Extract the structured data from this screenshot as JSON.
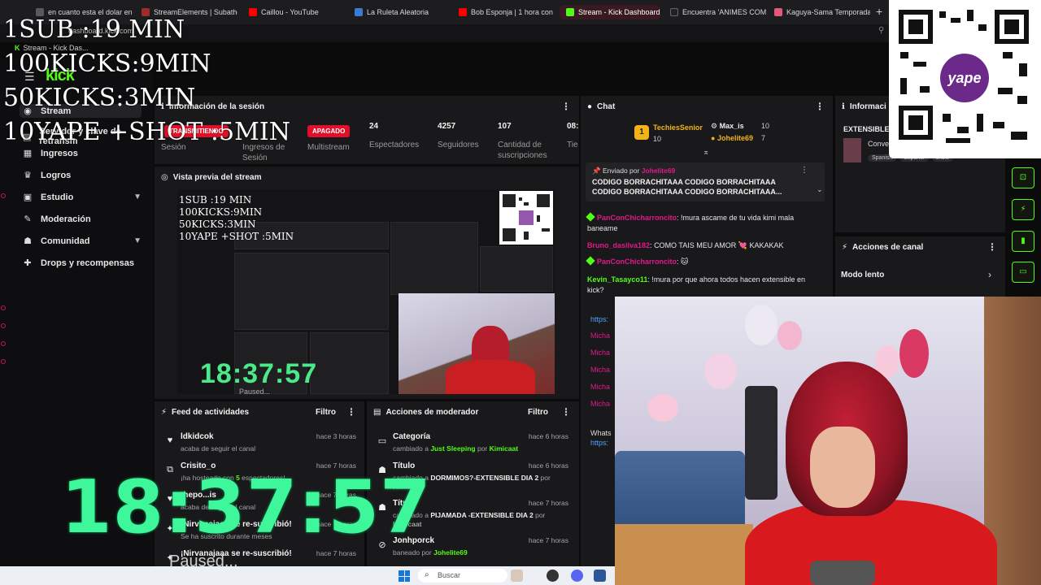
{
  "browser": {
    "tabs": [
      {
        "label": "en cuanto esta el dolar en",
        "color": "#5a5a5a"
      },
      {
        "label": "StreamElements | Subatho",
        "color": "#9b2d2d"
      },
      {
        "label": "Caillou - YouTube",
        "color": "#ff0000"
      },
      {
        "label": "La Ruleta Aleatoria",
        "color": "#3a7bd5"
      },
      {
        "label": "Bob Esponja | 1 hora con",
        "color": "#ff0000"
      },
      {
        "label": "Stream - Kick Dashboard",
        "color": "#53fc18"
      },
      {
        "label": "Encuentra 'ANIMES COM",
        "color": "#222"
      },
      {
        "label": "Kaguya-Sama Temporada",
        "color": "#e05a7a"
      }
    ],
    "address": "dashboard.kick.com",
    "pinned_tab": "Stream - Kick Das..."
  },
  "sidebar": {
    "logo": "kick",
    "items": [
      {
        "label": "Stream",
        "icon": "stream-icon"
      },
      {
        "label": "Servidor y clave de retransm",
        "icon": "server-icon"
      },
      {
        "label": "Ingresos",
        "icon": "money-icon"
      },
      {
        "label": "Logros",
        "icon": "trophy-icon"
      },
      {
        "label": "Estudio",
        "icon": "studio-icon"
      },
      {
        "label": "Moderación",
        "icon": "wrench-icon"
      },
      {
        "label": "Comunidad",
        "icon": "community-icon"
      },
      {
        "label": "Drops y recompensas",
        "icon": "gift-icon"
      }
    ]
  },
  "session": {
    "title": "Información de la sesión",
    "status_live": "TRANSMITIENDO",
    "status_off": "APAGADO",
    "stats": [
      {
        "value": "",
        "label": "Sesión"
      },
      {
        "value": "",
        "label": "Ingresos de Sesión"
      },
      {
        "value": "",
        "label": "Multistream"
      },
      {
        "value": "24",
        "label": "Espectadores"
      },
      {
        "value": "4257",
        "label": "Seguidores"
      },
      {
        "value": "107",
        "label": "Cantidad de suscripciones"
      },
      {
        "value": "08:",
        "label": "Tie"
      }
    ]
  },
  "preview": {
    "title": "Vista previa del stream",
    "mini_clock": "18:37:57",
    "mini_paused": "Paused..."
  },
  "feed": {
    "title": "Feed de actividades",
    "filter": "Filtro",
    "rows": [
      {
        "icon": "heart-icon",
        "user": "ldkidcok",
        "pre": "acaba de seguir el canal",
        "hl": "",
        "post": "",
        "time": "hace 3 horas"
      },
      {
        "icon": "host-icon",
        "user": "Crisito_o",
        "pre": "¡ha hosteado con ",
        "hl": "5",
        "post": " espectadores!",
        "time": "hace 7 horas"
      },
      {
        "icon": "heart-icon",
        "user": "thepo...is",
        "pre": "acaba de seguir el canal",
        "hl": "",
        "post": "",
        "time": "hace 7 horas"
      },
      {
        "icon": "star-icon",
        "user": "¡Nirvanajaaa se re-suscribió!",
        "pre": "Se ha suscrito durante ",
        "hl": "",
        "post": "meses",
        "time": "hace 7 horas"
      },
      {
        "icon": "star-icon",
        "user": "¡Nirvanajaaa se re-suscribió!",
        "pre": "",
        "hl": "",
        "post": "",
        "time": "hace 7 horas"
      }
    ]
  },
  "mod": {
    "title": "Acciones de moderador",
    "filter": "Filtro",
    "rows": [
      {
        "icon": "category-icon",
        "title": "Categoría",
        "pre": "cambiado a ",
        "hl": "Just Sleeping",
        "mid": " por ",
        "hl2": "Kimicaat",
        "time": "hace 6 horas"
      },
      {
        "icon": "user-icon",
        "title": "Título",
        "pre": "cambiado a ",
        "hl": "DORMIMOS?-EXTENSIBLE DIA 2",
        "mid": " por",
        "hl2": "Kimicaat",
        "time": "hace 6 horas"
      },
      {
        "icon": "user-icon",
        "title": "Título",
        "pre": "cambiado a ",
        "hl": "PIJAMADA -EXTENSIBLE DIA 2",
        "mid": " por",
        "hl2": "Kimicaat",
        "time": "hace 7 horas"
      },
      {
        "icon": "ban-icon",
        "title": "Jonhporck",
        "pre": "baneado por ",
        "hl": "",
        "mid": "",
        "hl2": "Johelite69",
        "time": "hace 7 horas"
      }
    ]
  },
  "chat": {
    "title": "Chat",
    "top_gifter": {
      "rank": "1",
      "name": "TechiesSenior",
      "count": "10"
    },
    "gifters": [
      {
        "name": "Max_is",
        "count": "10"
      },
      {
        "name": "Johelite69",
        "count": "7"
      }
    ],
    "pinned_by": "Enviado por",
    "pinned_user": "Johelite69",
    "pinned_msg": "CODIGO BORRACHITAAA CODIGO BORRACHITAAA CODIGO BORRACHITAAA CODIGO BORRACHITAAA...",
    "messages": [
      {
        "user": "PanConChicharroncito",
        "color": "#e0198a",
        "text": "!mura ascame de tu vida kimi mala baneame",
        "badge": true
      },
      {
        "user": "Bruno_dasilva182",
        "color": "#e0198a",
        "text": "COMO TAIS MEU AMOR 💘 KAKAKAK",
        "badge": false
      },
      {
        "user": "PanConChicharroncito",
        "color": "#e0198a",
        "text": "🐱",
        "badge": true
      },
      {
        "user": "Kevin_Tasayco11",
        "color": "#53fc18",
        "text": "!mura por que ahora todos hacen extensible en kick?",
        "badge": false
      }
    ],
    "partial_users": [
      "https:",
      "Micha",
      "Micha",
      "Micha",
      "Micha",
      "Micha",
      "Whats",
      "https:"
    ]
  },
  "info_panel": {
    "title": "Informaci",
    "sub": "EXTENSIBLE",
    "conv": "Conve",
    "tags": [
      "Spanish",
      "Español",
      "show"
    ]
  },
  "channel_actions": {
    "title": "Acciones de canal",
    "slow_mode": "Modo lento"
  },
  "overlay": {
    "lines": [
      "1SUB :19 MIN",
      "100KICKS:9MIN",
      "50KICKS:3MIN",
      "10YAPE +SHOT :5MIN"
    ],
    "clock": "18:37:57",
    "paused": "Paused..."
  },
  "qr": {
    "brand": "yape"
  },
  "taskbar": {
    "search_placeholder": "Buscar"
  },
  "colors": {
    "accent": "#53fc18",
    "live": "#e0102a",
    "clock": "#3ef79a"
  }
}
